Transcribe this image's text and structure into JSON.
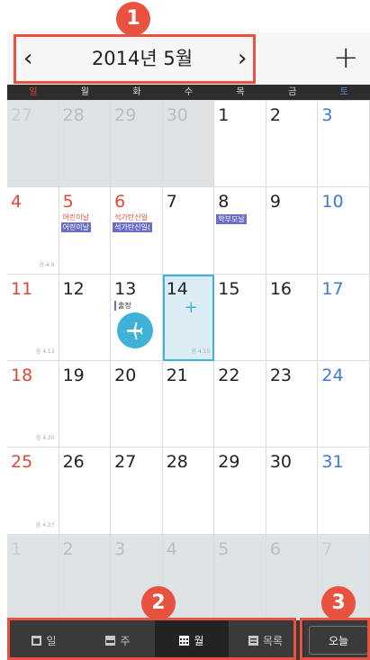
{
  "header": {
    "prev": "‹",
    "title": "2014년 5월",
    "next": "›",
    "add": "+"
  },
  "badges": [
    "1",
    "2",
    "3"
  ],
  "weekdays": [
    "일",
    "월",
    "화",
    "수",
    "목",
    "금",
    "토"
  ],
  "days": {
    "r1": [
      "27",
      "28",
      "29",
      "30",
      "1",
      "2",
      "3"
    ],
    "r2": [
      "4",
      "5",
      "6",
      "7",
      "8",
      "9",
      "10"
    ],
    "r3": [
      "11",
      "12",
      "13",
      "14",
      "15",
      "16",
      "17"
    ],
    "r4": [
      "18",
      "19",
      "20",
      "21",
      "22",
      "23",
      "24"
    ],
    "r5": [
      "25",
      "26",
      "27",
      "28",
      "29",
      "30",
      "31"
    ],
    "r6": [
      "1",
      "2",
      "3",
      "4",
      "5",
      "6",
      "7"
    ]
  },
  "events": {
    "childrens_day_holiday": "어린이날",
    "childrens_day_event": "어린이날",
    "buddha_holiday": "석가탄신일",
    "buddha_event": "석가탄신일(",
    "parents_day_event": "학부모날",
    "business_trip_memo": "출장",
    "lunar_4_6": "음 4.6",
    "lunar_4_13": "음 4.13",
    "lunar_4_15": "음 4.15",
    "lunar_4_20": "음 4.20",
    "lunar_4_27": "음 4.27"
  },
  "today_plus": "+",
  "tabs": [
    "일",
    "주",
    "월",
    "목록"
  ],
  "today_button": "오늘",
  "colors": {
    "accent": "#3fb3d7",
    "sunday": "#e2483a",
    "saturday": "#3a7bd5",
    "event": "#6a6ec6",
    "annotation": "#e8523f"
  }
}
